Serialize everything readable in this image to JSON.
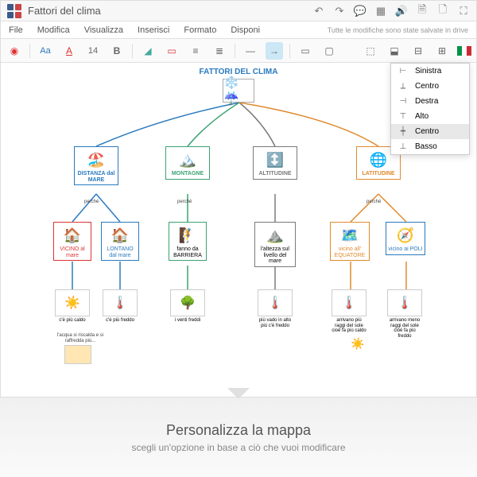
{
  "title": "Fattori del clima",
  "menubar": [
    "File",
    "Modifica",
    "Visualizza",
    "Inserisci",
    "Formato",
    "Disponi"
  ],
  "save_status": "Tutte le modifiche sono state salvate in drive",
  "toolbar": {
    "font_label": "Aa",
    "size": "14",
    "bold": "B"
  },
  "dropdown": {
    "items": [
      {
        "icon": "⊢",
        "label": "Sinistra"
      },
      {
        "icon": "⟂",
        "label": "Centro"
      },
      {
        "icon": "⊣",
        "label": "Destra"
      },
      {
        "icon": "⊤",
        "label": "Alto"
      },
      {
        "icon": "┿",
        "label": "Centro"
      },
      {
        "icon": "⊥",
        "label": "Basso"
      }
    ],
    "hover_index": 4
  },
  "map": {
    "root": "FATTORI DEL CLIMA",
    "branches": [
      {
        "color": "#2a7abf",
        "label": "DISTANZA dal MARE",
        "icon": "🏖️",
        "kids": [
          {
            "label": "VICINO al mare",
            "color": "#d33",
            "icon": "🏠"
          },
          {
            "label": "LONTANO dal mare",
            "color": "#2a7abf",
            "icon": "🏠"
          }
        ],
        "grandkids": [
          {
            "label": "c'è più caldo",
            "icon": "☀️"
          },
          {
            "label": "c'è più freddo",
            "icon": "🌡️"
          }
        ],
        "note": "l'acqua si riscalda e si raffredda più..."
      },
      {
        "color": "#3aa371",
        "label": "MONTAGNE",
        "icon": "🏔️",
        "kids": [
          {
            "label": "fanno da BARRIERA",
            "icon": "🧗",
            "color": "#3aa371"
          }
        ],
        "grandkids": [
          {
            "label": "i venti freddi",
            "icon": "🌳"
          }
        ]
      },
      {
        "color": "#7a7a7a",
        "label": "ALTITUDINE",
        "icon": "↕️",
        "kids": [
          {
            "label": "l'altezza sul livello del mare",
            "icon": "⛰️",
            "color": "#7a7a7a"
          }
        ],
        "grandkids": [
          {
            "label": "più vado in alto più c'è freddo",
            "icon": "🌡️"
          }
        ]
      },
      {
        "color": "#e08a2c",
        "label": "LATITUDINE",
        "icon": "🌐",
        "kids": [
          {
            "label": "vicino all' EQUATORE",
            "icon": "🗺️",
            "color": "#e08a2c"
          },
          {
            "label": "vicino ai POLI",
            "icon": "🧭",
            "color": "#2a7abf"
          }
        ],
        "grandkids": [
          {
            "label": "arrivano più raggi del sole cioè fa più caldo",
            "icon": "🌡️"
          },
          {
            "label": "arrivano meno raggi del sole cioè fa più freddo",
            "icon": "🌡️"
          }
        ]
      }
    ],
    "connector": "perché"
  },
  "caption": {
    "title": "Personalizza la mappa",
    "sub": "scegli un'opzione in base a ciò che vuoi modificare"
  }
}
